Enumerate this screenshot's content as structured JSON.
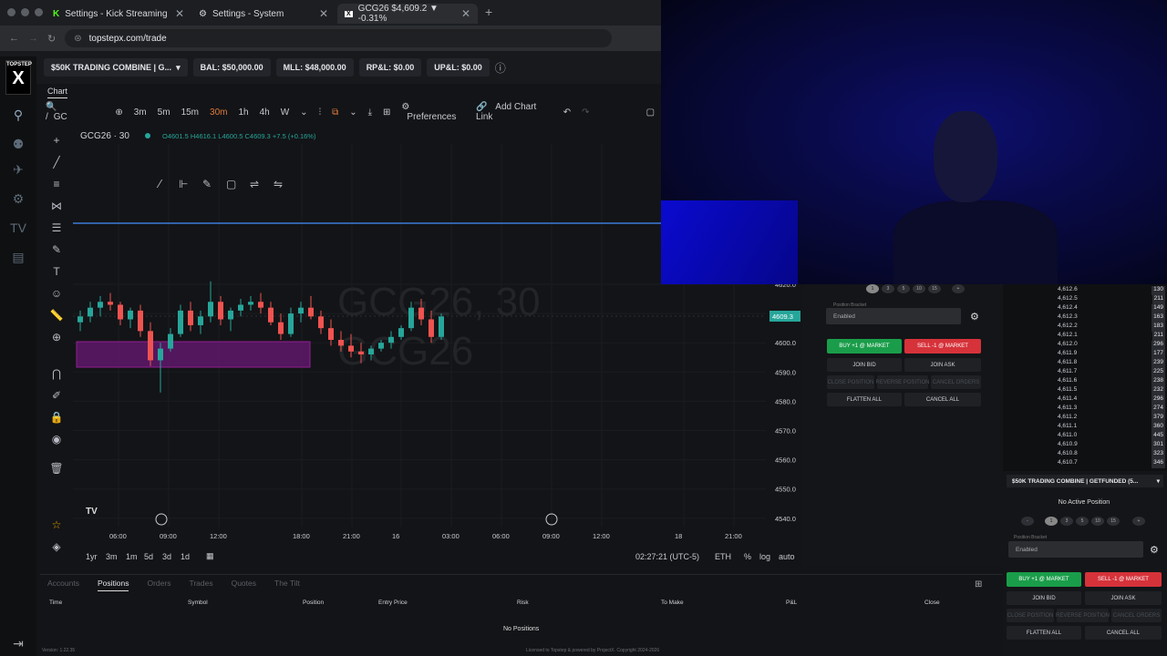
{
  "browser": {
    "tabs": [
      {
        "label": "Settings - Kick Streaming",
        "icon": "kick-icon"
      },
      {
        "label": "Settings - System",
        "icon": "gear-icon"
      },
      {
        "label": "GCG26 $4,609.2 ▼ -0.31%",
        "icon": "topstep-icon"
      }
    ],
    "url": "topstepx.com/trade"
  },
  "appbar": {
    "account": "$50K TRADING COMBINE | G...",
    "bal": "BAL: $50,000.00",
    "mll": "MLL: $48,000.00",
    "rpl": "RP&L: $0.00",
    "upl": "UP&L: $0.00"
  },
  "logo": {
    "top": "TOPSTEP",
    "mark": "X"
  },
  "chart_tab": "Chart",
  "toolbar": {
    "symbol": "GC",
    "intervals": [
      "3m",
      "5m",
      "15m",
      "30m",
      "1h",
      "4h",
      "W"
    ],
    "active_interval": "30m",
    "preferences": "Preferences",
    "add_link": "Add Chart Link"
  },
  "legend": {
    "symbol": "GCG26 · 30",
    "ohlc": "O4601.5 H4616.1 L4600.5 C4609.3 +7.5 (+0.16%)"
  },
  "watermark": {
    "line1": "GCG26, 30",
    "line2": "GCG26"
  },
  "price_axis": [
    "4620.0",
    "4610.0",
    "4600.0",
    "4590.0",
    "4580.0",
    "4570.0",
    "4560.0",
    "4550.0",
    "4540.0"
  ],
  "price_label": "4609.3",
  "time_axis": [
    "06:00",
    "09:00",
    "12:00",
    "18:00",
    "21:00",
    "16",
    "03:00",
    "06:00",
    "09:00",
    "12:00",
    "18",
    "21:00"
  ],
  "timeframes": [
    "1yr",
    "3m",
    "1m",
    "5d",
    "3d",
    "1d"
  ],
  "clock": "02:27:21 (UTC-5)",
  "session": "ETH",
  "scale_opts": [
    "%",
    "log",
    "auto"
  ],
  "order_panel": {
    "contracts": [
      "1",
      "3",
      "5",
      "10",
      "15"
    ],
    "bracket_label": "Position Bracket",
    "bracket_value": "Enabled",
    "buy": "BUY +1 @ MARKET",
    "sell": "SELL -1 @ MARKET",
    "join_bid": "JOIN BID",
    "join_ask": "JOIN ASK",
    "close_position": "CLOSE POSITION",
    "reverse_position": "REVERSE POSITION",
    "cancel_orders": "CANCEL ORDERS",
    "flatten_all": "FLATTEN ALL",
    "cancel_all": "CANCEL ALL"
  },
  "dom": [
    {
      "price": "4,612.6",
      "vol": "130"
    },
    {
      "price": "4,612.5",
      "vol": "211"
    },
    {
      "price": "4,612.4",
      "vol": "149"
    },
    {
      "price": "4,612.3",
      "vol": "163"
    },
    {
      "price": "4,612.2",
      "vol": "183"
    },
    {
      "price": "4,612.1",
      "vol": "211"
    },
    {
      "price": "4,612.0",
      "vol": "296"
    },
    {
      "price": "4,611.9",
      "vol": "177"
    },
    {
      "price": "4,611.8",
      "vol": "239"
    },
    {
      "price": "4,611.7",
      "vol": "225"
    },
    {
      "price": "4,611.6",
      "vol": "238"
    },
    {
      "price": "4,611.5",
      "vol": "232"
    },
    {
      "price": "4,611.4",
      "vol": "296"
    },
    {
      "price": "4,611.3",
      "vol": "274"
    },
    {
      "price": "4,611.2",
      "vol": "379"
    },
    {
      "price": "4,611.1",
      "vol": "360"
    },
    {
      "price": "4,611.0",
      "vol": "445"
    },
    {
      "price": "4,610.9",
      "vol": "301"
    },
    {
      "price": "4,610.8",
      "vol": "323"
    },
    {
      "price": "4,610.7",
      "vol": "346"
    }
  ],
  "right_panel": {
    "account": "$50K TRADING COMBINE | GETFUNDED (5...",
    "no_position": "No Active Position",
    "bracket_label": "Position Bracket",
    "bracket_value": "Enabled"
  },
  "bottom": {
    "tabs": [
      "Accounts",
      "Positions",
      "Orders",
      "Trades",
      "Quotes",
      "The Tilt"
    ],
    "active_tab": "Positions",
    "columns": [
      "Time",
      "Symbol",
      "Position",
      "Entry Price",
      "Risk",
      "To Make",
      "P&L",
      "Close"
    ],
    "empty": "No Positions"
  },
  "status": {
    "version": "Version: 1.22.35",
    "license": "Licensed to Topstep & powered by ProjectX. Copyright 2024-2026"
  },
  "colors": {
    "up": "#26a69a",
    "down": "#ef5350",
    "buy": "#1a9d4a",
    "sell": "#d6323a",
    "box": "#a020a0",
    "hline": "#3d7bd9"
  }
}
